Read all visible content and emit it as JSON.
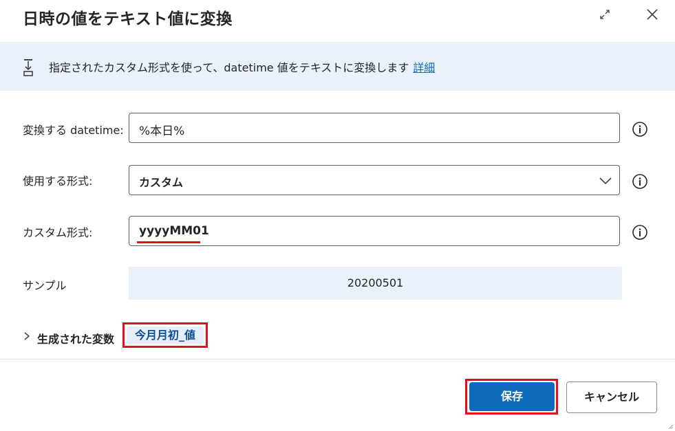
{
  "dialog": {
    "title": "日時の値をテキスト値に変換"
  },
  "banner": {
    "text": "指定されたカスタム形式を使って、datetime 値をテキストに変換します",
    "link_text": "詳細"
  },
  "fields": {
    "datetime": {
      "label": "変換する datetime:",
      "value": "%本日%"
    },
    "format": {
      "label": "使用する形式:",
      "value": "カスタム"
    },
    "custom_format": {
      "label": "カスタム形式:",
      "value": "yyyyMM01"
    },
    "sample": {
      "label": "サンプル",
      "value": "20200501"
    }
  },
  "variables": {
    "label": "生成された変数",
    "chip": "今月月初_値"
  },
  "buttons": {
    "save": "保存",
    "cancel": "キャンセル"
  },
  "colors": {
    "accent": "#0f6cbd",
    "banner_bg": "#e9f1fb",
    "highlight_red": "#e3101b"
  },
  "icons": {
    "expand": "expand-icon",
    "close": "close-icon",
    "banner": "convert-icon",
    "info": "info-icon",
    "dropdown": "chevron-down-icon",
    "variables_toggle": "chevron-right-icon"
  }
}
